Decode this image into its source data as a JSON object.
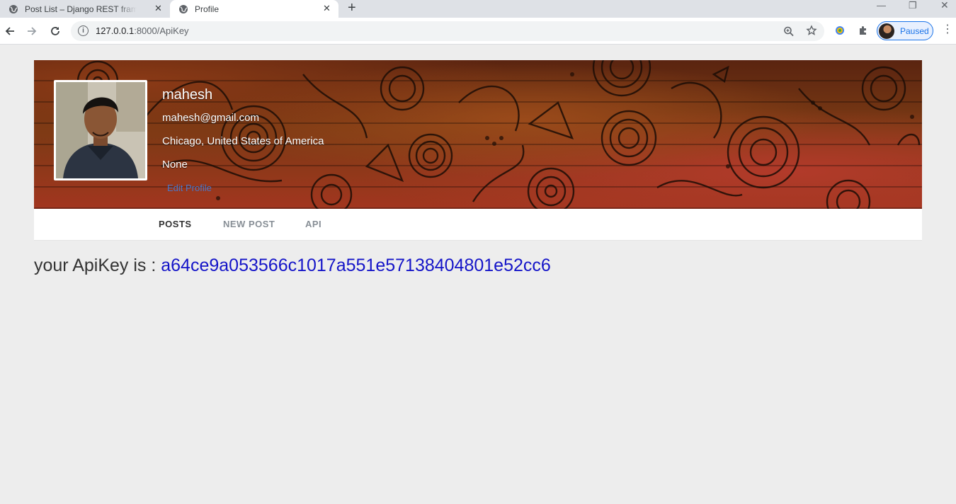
{
  "browser": {
    "tabs": [
      {
        "title": "Post List – Django REST framework",
        "active": false
      },
      {
        "title": "Profile",
        "active": true
      }
    ],
    "new_tab_symbol": "+",
    "url_host": "127.0.0.1",
    "url_path": ":8000/ApiKey",
    "profile_status": "Paused",
    "icons": [
      "globe-icon",
      "back-icon",
      "forward-icon",
      "reload-icon",
      "info-icon",
      "zoom-icon",
      "star-icon",
      "extension-icon",
      "puzzle-icon",
      "menu-icon"
    ]
  },
  "profile": {
    "name": "mahesh",
    "email": "mahesh@gmail.com",
    "location": "Chicago, United States of America",
    "bio": "None",
    "edit_label": "Edit Profile"
  },
  "nav": {
    "items": [
      {
        "label": "POSTS",
        "active": true
      },
      {
        "label": "NEW POST",
        "active": false
      },
      {
        "label": "API",
        "active": false
      }
    ]
  },
  "apikey": {
    "prefix": "your ApiKey is : ",
    "value": "a64ce9a053566c1017a551e57138404801e52cc6"
  },
  "colors": {
    "page_bg": "#ededed",
    "key_color": "#1414c8",
    "link_color": "#4a76c9",
    "chip_color": "#1a73e8"
  }
}
